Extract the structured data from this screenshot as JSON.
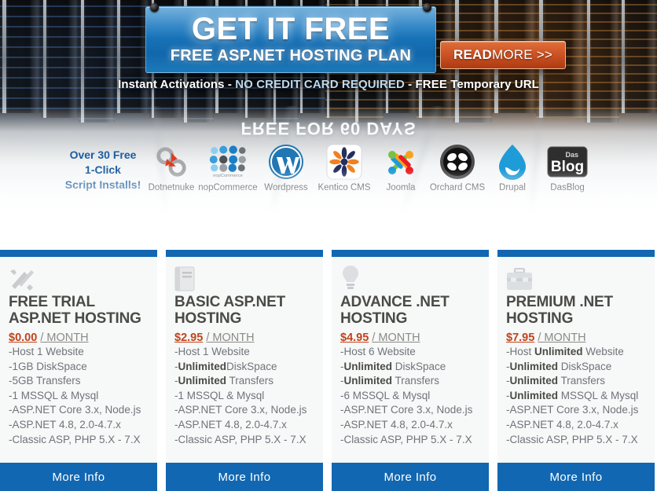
{
  "hero": {
    "sign_title": "GET IT FREE",
    "sign_subtitle": "FREE ASP.NET HOSTING PLAN",
    "read_more_strong": "READ",
    "read_more_rest": " MORE >>",
    "tagline_part1": "Instant Activations - ",
    "tagline_highlight": "NO CREDIT CARD REQUIRED",
    "tagline_part2": " - FREE Temporary URL",
    "reflection_text": "FREE FOR 60 DAYS"
  },
  "scripts": {
    "promo_line1": "Over 30 Free",
    "promo_line2": "1-Click",
    "promo_line3": "Script Installs!",
    "items": [
      {
        "name": "Dotnetnuke",
        "icon": "dotnetnuke-icon"
      },
      {
        "name": "nopCommerce",
        "icon": "nopcommerce-icon"
      },
      {
        "name": "Wordpress",
        "icon": "wordpress-icon"
      },
      {
        "name": "Kentico CMS",
        "icon": "kentico-icon"
      },
      {
        "name": "Joomla",
        "icon": "joomla-icon"
      },
      {
        "name": "Orchard CMS",
        "icon": "orchard-icon"
      },
      {
        "name": "Drupal",
        "icon": "drupal-icon"
      },
      {
        "name": "DasBlog",
        "icon": "dasblog-icon"
      }
    ]
  },
  "colors": {
    "accent_blue": "#1167b1",
    "price_orange": "#c0431b",
    "title_gray": "#4b4b46",
    "feature_gray": "#6f7479",
    "card_bg": "#f7f8f8"
  },
  "plans": [
    {
      "icon": "tools-icon",
      "title": "FREE TRIAL ASP.NET HOSTING",
      "price": "$0.00",
      "period": "/ MONTH",
      "button": "More Info",
      "features": [
        {
          "text": "-Host 1 Website"
        },
        {
          "text": "-1GB DiskSpace"
        },
        {
          "text": "-5GB Transfers"
        },
        {
          "text": "-1 MSSQL & Mysql"
        },
        {
          "text": "-ASP.NET Core 3.x, Node.js"
        },
        {
          "text": "-ASP.NET 4.8, 2.0-4.7.x"
        },
        {
          "text": "-Classic ASP, PHP 5.X - 7.X"
        }
      ]
    },
    {
      "icon": "book-icon",
      "title": "BASIC ASP.NET HOSTING",
      "price": "$2.95",
      "period": "/ MONTH",
      "button": "More Info",
      "features": [
        {
          "text": "-Host 1 Website"
        },
        {
          "pre": "-",
          "bold": "Unlimited",
          "post": "DiskSpace"
        },
        {
          "pre": "-",
          "bold": "Unlimited",
          "post": " Transfers"
        },
        {
          "text": "-1 MSSQL & Mysql"
        },
        {
          "text": "-ASP.NET Core 3.x, Node.js"
        },
        {
          "text": "-ASP.NET 4.8, 2.0-4.7.x"
        },
        {
          "text": "-Classic ASP, PHP 5.X - 7.X"
        }
      ]
    },
    {
      "icon": "lightbulb-icon",
      "title": "ADVANCE .NET HOSTING",
      "price": "$4.95",
      "period": "/ MONTH",
      "button": "More Info",
      "features": [
        {
          "text": "-Host 6 Website"
        },
        {
          "pre": "-",
          "bold": "Unlimited",
          "post": " DiskSpace"
        },
        {
          "pre": "-",
          "bold": "Unlimited",
          "post": " Transfers"
        },
        {
          "text": "-6 MSSQL & Mysql"
        },
        {
          "text": "-ASP.NET Core 3.x, Node.js"
        },
        {
          "text": "-ASP.NET 4.8, 2.0-4.7.x"
        },
        {
          "text": "-Classic ASP, PHP 5.X - 7.X"
        }
      ]
    },
    {
      "icon": "briefcase-icon",
      "title": "PREMIUM .NET HOSTING",
      "price": "$7.95",
      "period": "/ MONTH",
      "button": "More Info",
      "features": [
        {
          "pre": "-Host ",
          "bold": "Unlimited",
          "post": " Website"
        },
        {
          "pre": "-",
          "bold": "Unlimited",
          "post": " DiskSpace"
        },
        {
          "pre": "-",
          "bold": "Unlimited",
          "post": " Transfers"
        },
        {
          "pre": "-",
          "bold": "Unlimited",
          "post": " MSSQL & Mysql"
        },
        {
          "text": "-ASP.NET Core 3.x, Node.js"
        },
        {
          "text": "-ASP.NET 4.8, 2.0-4.7.x"
        },
        {
          "text": "-Classic ASP, PHP 5.X - 7.X"
        }
      ]
    }
  ]
}
